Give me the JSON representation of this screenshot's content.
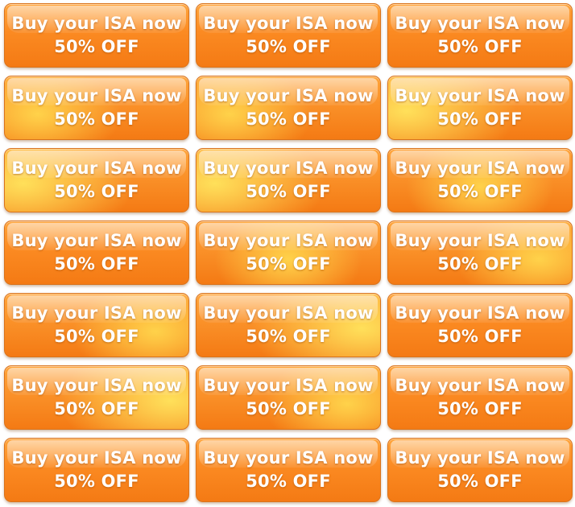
{
  "buttons": [
    {
      "line1": "Buy your ISA now",
      "line2": "50% OFF"
    },
    {
      "line1": "Buy your ISA now",
      "line2": "50% OFF"
    },
    {
      "line1": "Buy your ISA now",
      "line2": "50% OFF"
    },
    {
      "line1": "Buy your ISA now",
      "line2": "50% OFF"
    },
    {
      "line1": "Buy your ISA now",
      "line2": "50% OFF"
    },
    {
      "line1": "Buy your ISA now",
      "line2": "50% OFF"
    },
    {
      "line1": "Buy your ISA now",
      "line2": "50% OFF"
    },
    {
      "line1": "Buy your ISA now",
      "line2": "50% OFF"
    },
    {
      "line1": "Buy your ISA now",
      "line2": "50% OFF"
    },
    {
      "line1": "Buy your ISA now",
      "line2": "50% OFF"
    },
    {
      "line1": "Buy your ISA now",
      "line2": "50% OFF"
    },
    {
      "line1": "Buy your ISA now",
      "line2": "50% OFF"
    },
    {
      "line1": "Buy your ISA now",
      "line2": "50% OFF"
    },
    {
      "line1": "Buy your ISA now",
      "line2": "50% OFF"
    },
    {
      "line1": "Buy your ISA now",
      "line2": "50% OFF"
    },
    {
      "line1": "Buy your ISA now",
      "line2": "50% OFF"
    },
    {
      "line1": "Buy your ISA now",
      "line2": "50% OFF"
    },
    {
      "line1": "Buy your ISA now",
      "line2": "50% OFF"
    },
    {
      "line1": "Buy your ISA now",
      "line2": "50% OFF"
    },
    {
      "line1": "Buy your ISA now",
      "line2": "50% OFF"
    },
    {
      "line1": "Buy your ISA now",
      "line2": "50% OFF"
    }
  ],
  "colors": {
    "button_orange": "#f47a14",
    "button_orange_light": "#ffa43a",
    "button_highlight_yellow": "#ffd24a",
    "text": "#ffffff"
  }
}
